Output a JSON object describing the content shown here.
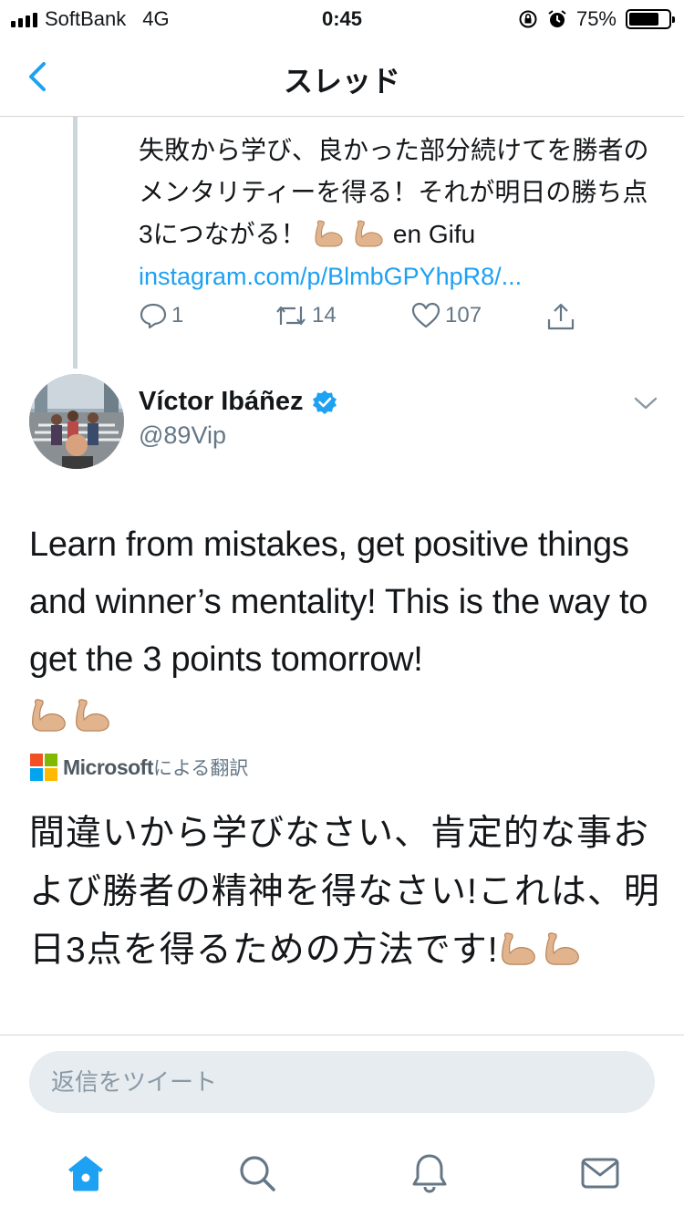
{
  "status_bar": {
    "carrier": "SoftBank",
    "network": "4G",
    "time": "0:45",
    "battery_percent": "75%",
    "battery_level": 0.75
  },
  "nav": {
    "title": "スレッド",
    "back_icon": "chevron-left-icon"
  },
  "previous_tweet": {
    "text": "失敗から学び、良かった部分続けてを勝者のメンタリティーを得る！それが明日の勝ち点3につながる！",
    "text_suffix": "en Gifu",
    "link": "instagram.com/p/BlmbGPYhpR8/...",
    "replies": "1",
    "retweets": "14",
    "likes": "107"
  },
  "tweet": {
    "author_name": "Víctor Ibáñez",
    "handle": "@89Vip",
    "body": "Learn from mistakes, get positive things and winner’s mentality! This is the way to get the 3 points tomorrow!",
    "translation_provider": "Microsoft",
    "translation_label": "による翻訳",
    "translation": "間違いから学びなさい、肯定的な事および勝者の精神を得なさい!これは、明日3点を得るための方法です!"
  },
  "reply": {
    "placeholder": "返信をツイート"
  },
  "tabs": [
    "home-icon",
    "search-icon",
    "notifications-icon",
    "messages-icon"
  ],
  "colors": {
    "accent": "#1da1f2",
    "secondary_text": "#657786",
    "verified": "#1da1f2"
  }
}
